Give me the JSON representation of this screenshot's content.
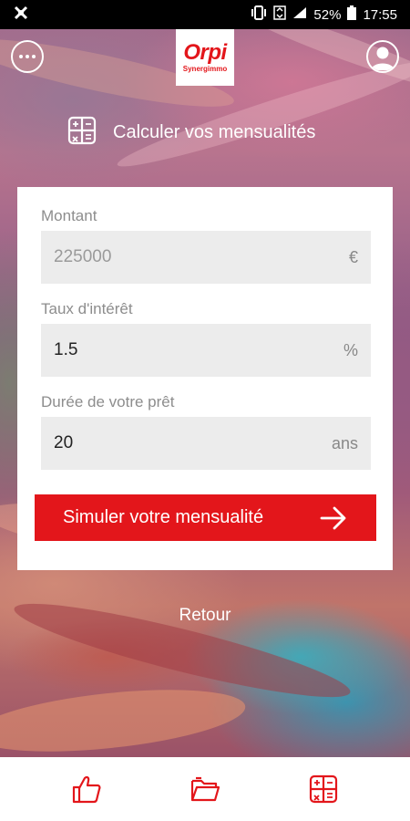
{
  "status_bar": {
    "battery_percent": "52%",
    "time": "17:55"
  },
  "header": {
    "logo_brand": "Orpi",
    "logo_subtitle": "Synergimmo"
  },
  "page": {
    "title": "Calculer vos mensualités"
  },
  "form": {
    "amount": {
      "label": "Montant",
      "placeholder": "225000",
      "value": "",
      "unit": "€"
    },
    "rate": {
      "label": "Taux d'intérêt",
      "value": "1.5",
      "unit": "%"
    },
    "duration": {
      "label": "Durée de votre prêt",
      "value": "20",
      "unit": "ans"
    },
    "submit_label": "Simuler votre mensualité"
  },
  "back_label": "Retour",
  "colors": {
    "brand_red": "#e3161b",
    "field_bg": "#ececec"
  },
  "bottom_nav": {
    "items": [
      {
        "icon": "thumbs-up-icon"
      },
      {
        "icon": "folder-open-icon"
      },
      {
        "icon": "calculator-icon"
      }
    ]
  }
}
